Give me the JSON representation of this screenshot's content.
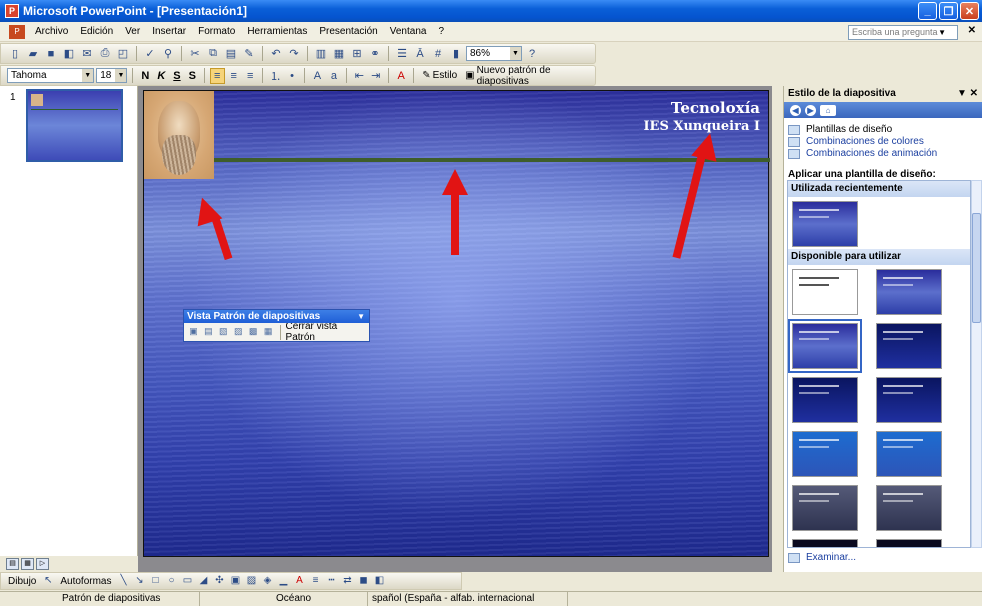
{
  "window": {
    "title": "Microsoft PowerPoint - [Presentación1]",
    "app_icon": "P"
  },
  "menubar": {
    "items": [
      "Archivo",
      "Edición",
      "Ver",
      "Insertar",
      "Formato",
      "Herramientas",
      "Presentación",
      "Ventana",
      "?"
    ],
    "ask_placeholder": "Escriba una pregunta"
  },
  "standard_toolbar": {
    "zoom": "86%"
  },
  "format_toolbar": {
    "font": "Tahoma",
    "size": "18",
    "bold": "N",
    "italic": "K",
    "underline": "S",
    "shadow": "S",
    "design_label": "Estilo",
    "new_master_label": "Nuevo patrón de diapositivas"
  },
  "slides_pane": {
    "slide_number": "1"
  },
  "slide": {
    "title": "Tecnoloxía",
    "subtitle": "IES Xunqueira I"
  },
  "floating_toolbar": {
    "title": "Vista Patrón de diapositivas",
    "close_label": "Cerrar vista Patrón"
  },
  "task_pane": {
    "title": "Estilo de la diapositiva",
    "links": [
      "Plantillas de diseño",
      "Combinaciones de colores",
      "Combinaciones de animación"
    ],
    "apply_label": "Aplicar una plantilla de diseño:",
    "recent_label": "Utilizada recientemente",
    "available_label": "Disponible para utilizar",
    "browse_label": "Examinar..."
  },
  "draw_toolbar": {
    "draw_label": "Dibujo",
    "autoshapes_label": "Autoformas"
  },
  "statusbar": {
    "view": "Patrón de diapositivas",
    "design": "Océano",
    "language": "spañol (España - alfab. internacional"
  },
  "colors": {
    "accent": "#0a5fd8",
    "annotation_arrow": "#e11414",
    "slide_line": "#3e5d2b"
  }
}
